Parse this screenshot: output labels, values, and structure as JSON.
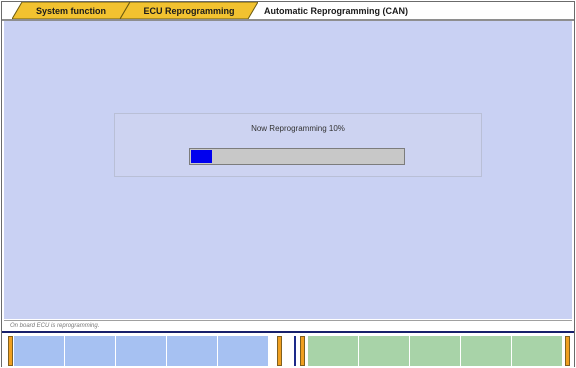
{
  "breadcrumb": {
    "items": [
      {
        "label": "System function"
      },
      {
        "label": "ECU Reprogramming"
      },
      {
        "label": "Automatic Reprogramming (CAN)"
      }
    ]
  },
  "progress": {
    "label": "Now Reprogramming  10%",
    "value": 0.1
  },
  "status": {
    "text": "On board ECU is reprogramming."
  },
  "function_keys": {
    "left_count": 5,
    "right_count": 5
  },
  "colors": {
    "panel": "#c9d1f3",
    "progress_fill": "#0000ee",
    "tab_active": "#f0c020",
    "left_keys": "#a6c1f2",
    "right_keys": "#a8d3a8"
  }
}
